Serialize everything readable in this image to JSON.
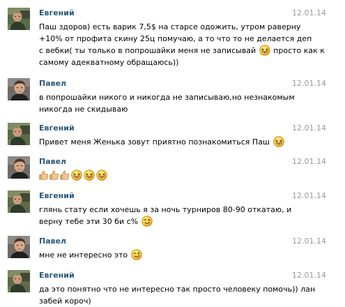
{
  "messages": [
    {
      "author": "Евгений",
      "date": "12.01.14",
      "line1": "Паш здоров) есть варик 7,5$ на старсе одожить, утром раверну",
      "line2": "+10% от профита скину 25ц помучаю, а то что то не делается деп",
      "line3a": "с вебки( ты только в попрошайки меня не записывай ",
      "line3b": " просто как к",
      "line4": "самому адекватному обращаюсь))",
      "emoji": "laughing-emoji"
    },
    {
      "author": "Павел",
      "date": "12.01.14",
      "line1": "в попрошайки никого и никогда не записываю,но незнакомым",
      "line2": "никогда не скидываю"
    },
    {
      "author": "Евгений",
      "date": "12.01.14",
      "line1": "Привет меня Женька зовут приятно познакомиться Паш",
      "emoji": "laughing-emoji"
    },
    {
      "author": "Павел",
      "date": "12.01.14",
      "emoji": [
        "thumbs-up-emoji",
        "thumbs-up-emoji",
        "thumbs-up-emoji",
        "laughing-emoji",
        "laughing-emoji",
        "laughing-emoji"
      ]
    },
    {
      "author": "Евгений",
      "date": "12.01.14",
      "line1": "глянь стату если хочешь я за ночь турниров 80-90 откатаю, и",
      "line2": "верну тебе эти 30 би с%",
      "emoji": "wink-emoji"
    },
    {
      "author": "Павел",
      "date": "12.01.14",
      "line1": "мне не интересно это",
      "emoji": "wink-emoji"
    },
    {
      "author": "Евгений",
      "date": "12.01.14",
      "line1": "да это понятно что не интересно так просто человеку помочь)) лан",
      "line2": "забей короч)"
    }
  ],
  "colors": {
    "author": "#2b587a",
    "date": "#999999",
    "text": "#000000",
    "emoji_face": "#f5c33b"
  }
}
